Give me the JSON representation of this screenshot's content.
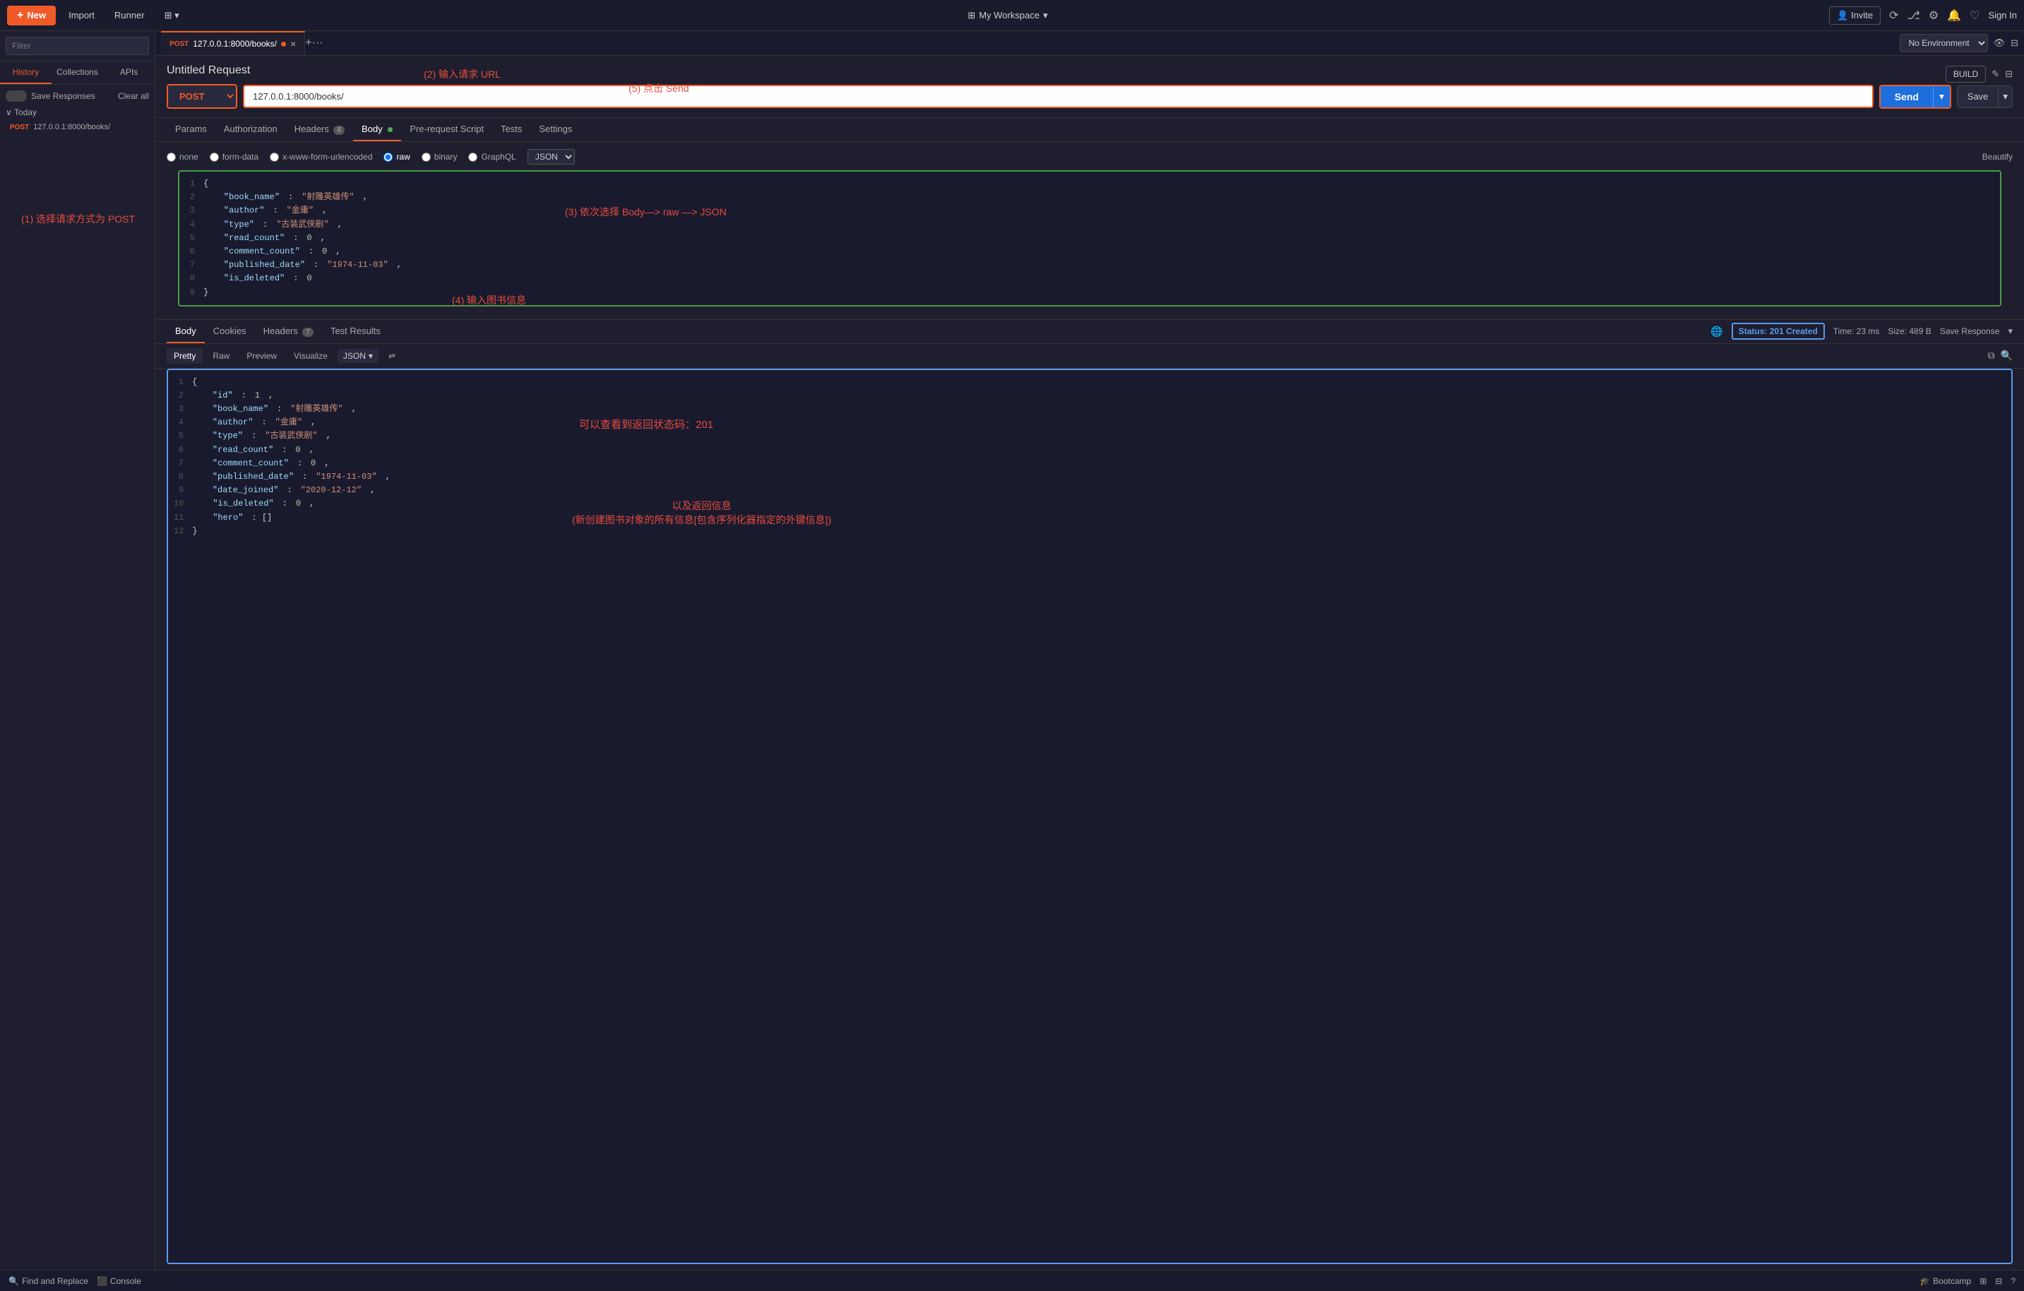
{
  "topnav": {
    "new_label": "New",
    "import_label": "Import",
    "runner_label": "Runner",
    "workspace_label": "My Workspace",
    "invite_label": "Invite",
    "signin_label": "Sign In"
  },
  "sidebar": {
    "filter_placeholder": "Filter",
    "tabs": [
      {
        "label": "History",
        "active": true
      },
      {
        "label": "Collections"
      },
      {
        "label": "APIs"
      }
    ],
    "save_responses_label": "Save Responses",
    "clear_all_label": "Clear all",
    "today_label": "Today",
    "history_items": [
      {
        "method": "POST",
        "url": "127.0.0.1:8000/books/"
      }
    ]
  },
  "tabs_bar": {
    "tab_method": "POST",
    "tab_url": "127.0.0.1:8000/books/",
    "env_label": "No Environment"
  },
  "request": {
    "title": "Untitled Request",
    "method": "POST",
    "url": "127.0.0.1:8000/books/",
    "send_label": "Send",
    "save_label": "Save",
    "build_label": "BUILD",
    "tabs": [
      {
        "label": "Params"
      },
      {
        "label": "Authorization"
      },
      {
        "label": "Headers",
        "badge": "8"
      },
      {
        "label": "Body",
        "active": true,
        "dot": true
      },
      {
        "label": "Pre-request Script"
      },
      {
        "label": "Tests"
      },
      {
        "label": "Settings"
      }
    ],
    "body_options": [
      {
        "label": "none"
      },
      {
        "label": "form-data"
      },
      {
        "label": "x-www-form-urlencoded"
      },
      {
        "label": "raw",
        "active": true
      },
      {
        "label": "binary"
      },
      {
        "label": "GraphQL"
      }
    ],
    "format_label": "JSON",
    "beautify_label": "Beautify",
    "code_lines": [
      {
        "num": 1,
        "content": "{"
      },
      {
        "num": 2,
        "content": "    \"book_name\":\"射雕英雄传\","
      },
      {
        "num": 3,
        "content": "    \"author\":\"金庸\","
      },
      {
        "num": 4,
        "content": "    \"type\":\"古装武侠剧\","
      },
      {
        "num": 5,
        "content": "    \"read_count\":0,"
      },
      {
        "num": 6,
        "content": "    \"comment_count\":0,"
      },
      {
        "num": 7,
        "content": "    \"published_date\":\"1974-11-03\","
      },
      {
        "num": 8,
        "content": "    \"is_deleted\":0"
      },
      {
        "num": 9,
        "content": "}"
      }
    ]
  },
  "response": {
    "tabs": [
      {
        "label": "Body",
        "active": true
      },
      {
        "label": "Cookies"
      },
      {
        "label": "Headers",
        "badge": "7"
      },
      {
        "label": "Test Results"
      }
    ],
    "status_label": "Status: 201 Created",
    "time_label": "Time: 23 ms",
    "size_label": "Size: 489 B",
    "save_response_label": "Save Response",
    "inner_tabs": [
      {
        "label": "Pretty",
        "active": true
      },
      {
        "label": "Raw"
      },
      {
        "label": "Preview"
      },
      {
        "label": "Visualize"
      }
    ],
    "format_label": "JSON",
    "response_lines": [
      {
        "num": 1,
        "content": "{"
      },
      {
        "num": 2,
        "key": "\"id\"",
        "val": " 1,"
      },
      {
        "num": 3,
        "key": "\"book_name\"",
        "val": " \"射雕英雄传\","
      },
      {
        "num": 4,
        "key": "\"author\"",
        "val": " \"金庸\","
      },
      {
        "num": 5,
        "key": "\"type\"",
        "val": " \"古装武侠剧\","
      },
      {
        "num": 6,
        "key": "\"read_count\"",
        "val": " 0,"
      },
      {
        "num": 7,
        "key": "\"comment_count\"",
        "val": " 0,"
      },
      {
        "num": 8,
        "key": "\"published_date\"",
        "val": " \"1974-11-03\","
      },
      {
        "num": 9,
        "key": "\"date_joined\"",
        "val": " \"2020-12-12\","
      },
      {
        "num": 10,
        "key": "\"is_deleted\"",
        "val": " 0,"
      },
      {
        "num": 11,
        "key": "\"hero\"",
        "val": " []"
      },
      {
        "num": 12,
        "content": "}"
      }
    ]
  },
  "annotations": {
    "step1": "(1) 选择请求方式为 POST",
    "step2": "(2) 输入请求 URL",
    "step3": "(3) 依次选择 Body—> raw —> JSON",
    "step4": "(4) 输入图书信息",
    "step5": "(5) 点击 Send",
    "step6": "可以查看到返回状态码：201",
    "step7": "以及返回信息\n(新创建图书对象的所有信息[包含序列化器指定的外键信息])"
  },
  "bottom": {
    "find_replace_label": "Find and Replace",
    "console_label": "Console",
    "bootcamp_label": "Bootcamp"
  }
}
